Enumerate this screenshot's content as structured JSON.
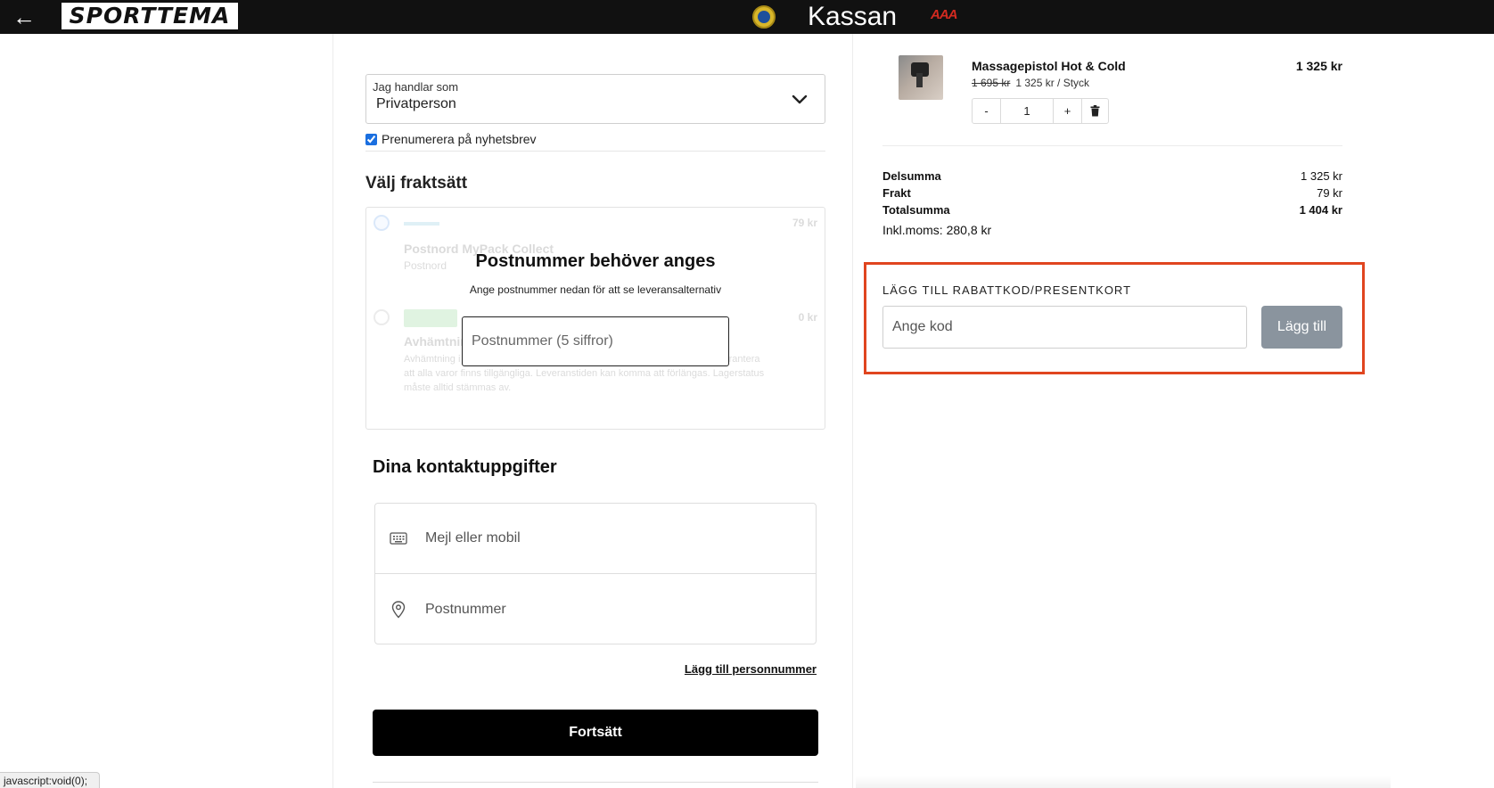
{
  "header": {
    "logo_text": "SPORTTEMA",
    "title": "Kassan",
    "badge_text": "AAA"
  },
  "customer_type": {
    "label": "Jag handlar som",
    "value": "Privatperson"
  },
  "newsletter": {
    "label": "Prenumerera på nyhetsbrev",
    "checked": true
  },
  "shipping": {
    "heading": "Välj fraktsätt",
    "options": [
      {
        "name": "Postnord MyPack Collect",
        "carrier": "Postnord",
        "price": "79 kr"
      },
      {
        "name": "Avhämtning",
        "carrier": "",
        "price": "0 kr",
        "description": "Avhämtning i butik. Du får ett meddelande när varan är redo. Vi kan inte garantera att alla varor finns tillgängliga. Leveranstiden kan komma att förlängas. Lagerstatus måste alltid stämmas av."
      }
    ],
    "overlay_title": "Postnummer behöver anges",
    "overlay_subtitle": "Ange postnummer nedan för att se leveransalternativ",
    "postcode_placeholder": "Postnummer (5 siffror)"
  },
  "contact": {
    "heading": "Dina kontaktuppgifter",
    "email_placeholder": "Mejl eller mobil",
    "postcode_placeholder": "Postnummer",
    "add_pnr_link": "Lägg till personnummer",
    "continue_label": "Fortsätt"
  },
  "cart": {
    "item": {
      "name": "Massagepistol Hot & Cold",
      "price": "1 325 kr",
      "old_price": "1 695 kr",
      "unit_price": "1 325 kr / Styck",
      "qty": "1",
      "minus": "-",
      "plus": "+"
    },
    "summary": {
      "subtotal_label": "Delsumma",
      "subtotal_value": "1 325 kr",
      "shipping_label": "Frakt",
      "shipping_value": "79 kr",
      "total_label": "Totalsumma",
      "total_value": "1 404 kr",
      "vat_text": "Inkl.moms: 280,8 kr"
    }
  },
  "discount": {
    "label": "LÄGG TILL RABATTKOD/PRESENTKORT",
    "placeholder": "Ange kod",
    "button_label": "Lägg till"
  },
  "status_bar": {
    "url": "javascript:void(0);"
  },
  "colors": {
    "header_bg": "#111111",
    "highlight_border": "#e0451f",
    "discount_button": "#8a949e",
    "continue_button": "#000000"
  }
}
